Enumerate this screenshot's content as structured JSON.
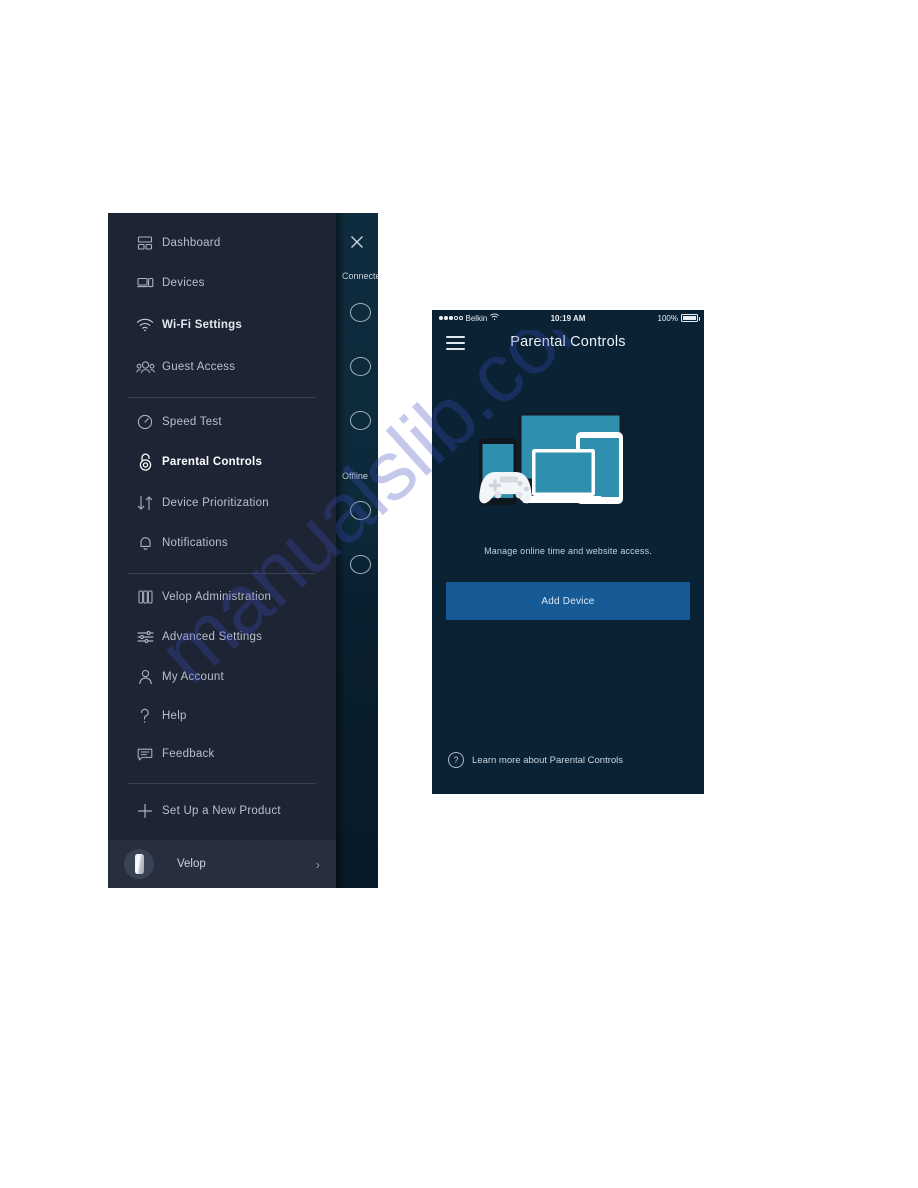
{
  "sidebar": {
    "close_icon": "close-icon",
    "items": [
      {
        "label": "Dashboard",
        "icon": "dashboard-icon",
        "emphasis": "normal"
      },
      {
        "label": "Devices",
        "icon": "devices-icon",
        "emphasis": "normal"
      },
      {
        "label": "Wi-Fi Settings",
        "icon": "wifi-icon",
        "emphasis": "semi"
      },
      {
        "label": "Guest Access",
        "icon": "guest-access-icon",
        "emphasis": "normal"
      },
      {
        "label": "Speed Test",
        "icon": "speedometer-icon",
        "emphasis": "normal"
      },
      {
        "label": "Parental Controls",
        "icon": "lock-icon",
        "emphasis": "selected"
      },
      {
        "label": "Device Prioritization",
        "icon": "up-down-arrows-icon",
        "emphasis": "normal"
      },
      {
        "label": "Notifications",
        "icon": "bell-icon",
        "emphasis": "normal"
      },
      {
        "label": "Velop Administration",
        "icon": "velop-nodes-icon",
        "emphasis": "normal"
      },
      {
        "label": "Advanced Settings",
        "icon": "sliders-icon",
        "emphasis": "normal"
      },
      {
        "label": "My Account",
        "icon": "person-icon",
        "emphasis": "normal"
      },
      {
        "label": "Help",
        "icon": "question-mark-icon",
        "emphasis": "normal"
      },
      {
        "label": "Feedback",
        "icon": "chat-bubble-icon",
        "emphasis": "normal"
      },
      {
        "label": "Set Up a New Product",
        "icon": "plus-icon",
        "emphasis": "normal"
      }
    ],
    "footer": {
      "label": "Velop",
      "avatar_icon": "velop-node-icon",
      "chevron_icon": "chevron-right-icon"
    },
    "background_panel": {
      "sections": [
        {
          "label": "Connected"
        },
        {
          "label": "Offline"
        }
      ]
    }
  },
  "phone": {
    "status_bar": {
      "carrier": "Belkin",
      "signal_icon": "signal-dots-icon",
      "wifi_icon": "wifi-icon",
      "time": "10:19 AM",
      "battery_percent": "100%",
      "battery_icon": "battery-full-icon"
    },
    "nav": {
      "menu_icon": "hamburger-menu-icon",
      "title": "Parental Controls"
    },
    "hero": {
      "illustration_icon": "devices-illustration",
      "caption": "Manage online time and website access."
    },
    "add_device_button": "Add Device",
    "learn_more": {
      "icon": "question-mark-circle-icon",
      "label": "Learn more about Parental Controls"
    }
  },
  "watermark": {
    "text": "manualslib.com"
  },
  "colors": {
    "drawer_bg": "#1d2433",
    "drawer_footer_bg": "#272e3d",
    "phone_bg": "#0a2234",
    "accent_button": "#175b96",
    "screen_teal": "#2b8cab",
    "label": "#b9c0cc"
  }
}
